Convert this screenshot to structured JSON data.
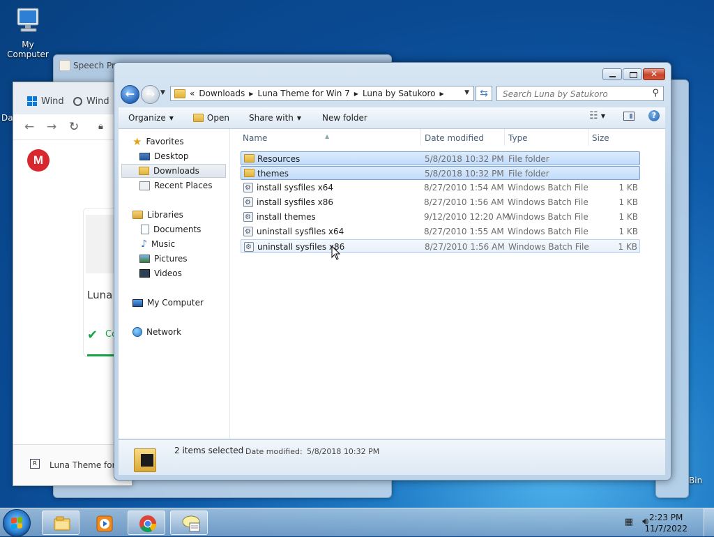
{
  "desktop": {
    "my_computer_label": "My Computer",
    "partial_left_label": "Da",
    "recycle_label": "Bin"
  },
  "background_windows": {
    "speech_title": "Speech Pro"
  },
  "chrome": {
    "tab1_label": "Wind",
    "tab2_label": "Wind",
    "page_heading": "Luna",
    "status_text": "Co",
    "download_label": "Luna Theme for"
  },
  "explorer": {
    "breadcrumb": [
      "Downloads",
      "Luna Theme for Win 7",
      "Luna by Satukoro"
    ],
    "search_placeholder": "Search Luna by Satukoro",
    "toolbar": {
      "organize": "Organize",
      "open": "Open",
      "share_with": "Share with",
      "new_folder": "New folder"
    },
    "nav": {
      "favorites": "Favorites",
      "desktop": "Desktop",
      "downloads": "Downloads",
      "recent_places": "Recent Places",
      "libraries": "Libraries",
      "documents": "Documents",
      "music": "Music",
      "pictures": "Pictures",
      "videos": "Videos",
      "my_computer": "My Computer",
      "network": "Network"
    },
    "columns": {
      "name": "Name",
      "date_modified": "Date modified",
      "type": "Type",
      "size": "Size"
    },
    "files": [
      {
        "name": "Resources",
        "date": "5/8/2018 10:32 PM",
        "type": "File folder",
        "size": "",
        "icon": "folder-icon",
        "selected": true
      },
      {
        "name": "themes",
        "date": "5/8/2018 10:32 PM",
        "type": "File folder",
        "size": "",
        "icon": "folder-icon",
        "selected": true
      },
      {
        "name": "install sysfiles x64",
        "date": "8/27/2010 1:54 AM",
        "type": "Windows Batch File",
        "size": "1 KB",
        "icon": "batch-file-icon",
        "selected": false
      },
      {
        "name": "install sysfiles x86",
        "date": "8/27/2010 1:56 AM",
        "type": "Windows Batch File",
        "size": "1 KB",
        "icon": "batch-file-icon",
        "selected": false
      },
      {
        "name": "install themes",
        "date": "9/12/2010 12:20 AM",
        "type": "Windows Batch File",
        "size": "1 KB",
        "icon": "batch-file-icon",
        "selected": false
      },
      {
        "name": "uninstall sysfiles x64",
        "date": "8/27/2010 1:55 AM",
        "type": "Windows Batch File",
        "size": "1 KB",
        "icon": "batch-file-icon",
        "selected": false
      },
      {
        "name": "uninstall sysfiles x86",
        "date": "8/27/2010 1:56 AM",
        "type": "Windows Batch File",
        "size": "1 KB",
        "icon": "batch-file-icon",
        "selected": false,
        "hovered": true
      }
    ],
    "details": {
      "selection": "2 items selected",
      "date_label": "Date modified:",
      "date_value": "5/8/2018 10:32 PM"
    }
  },
  "taskbar": {
    "time": "2:23 PM",
    "date": "11/7/2022"
  },
  "colors": {
    "selection": "#c1dcfc",
    "close_button": "#c7432a",
    "accent": "#2866b8"
  }
}
